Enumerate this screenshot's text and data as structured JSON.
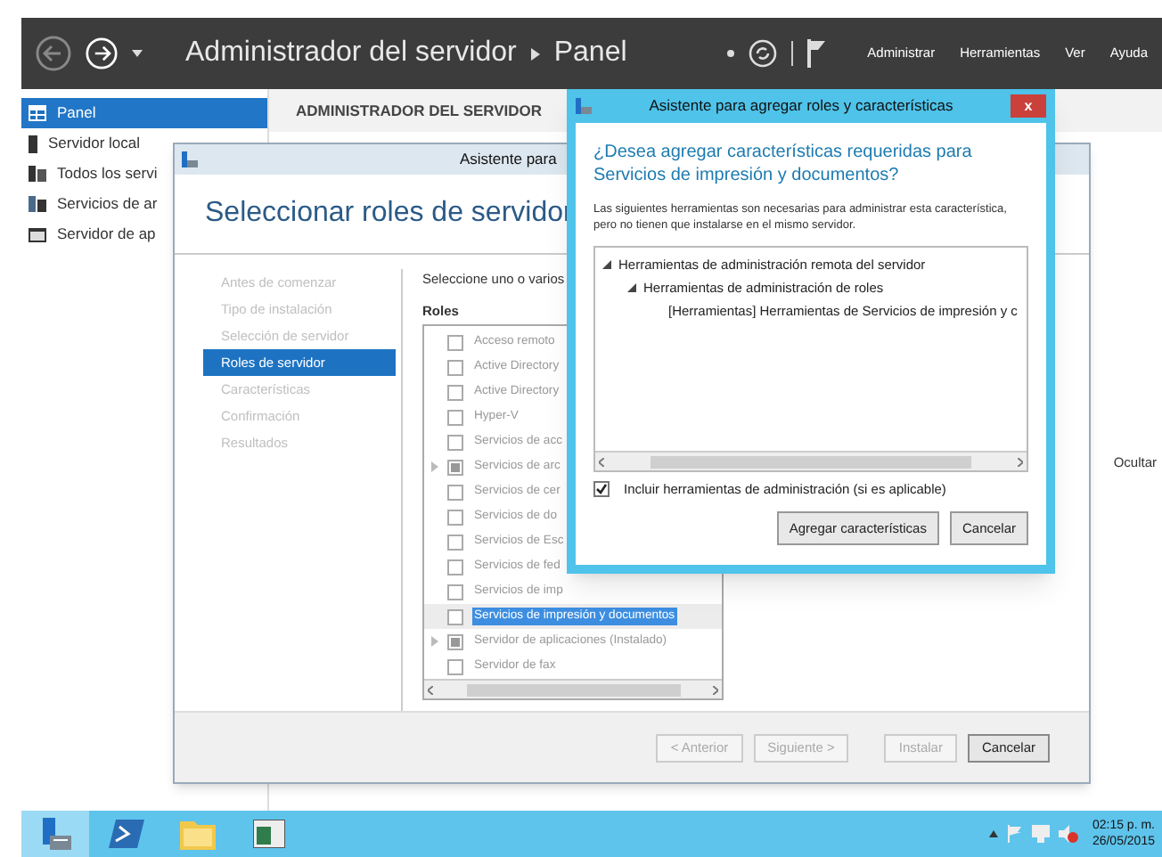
{
  "server_manager": {
    "breadcrumb": [
      "Administrador del servidor",
      "Panel"
    ],
    "menus": [
      "Administrar",
      "Herramientas",
      "Ver",
      "Ayuda"
    ],
    "sidebar": [
      {
        "label": "Panel",
        "selected": true,
        "kind": "dashboard"
      },
      {
        "label": "Servidor local",
        "selected": false,
        "kind": "server"
      },
      {
        "label": "Todos los servi",
        "selected": false,
        "kind": "servers"
      },
      {
        "label": "Servicios de ar",
        "selected": false,
        "kind": "files"
      },
      {
        "label": "Servidor de ap",
        "selected": false,
        "kind": "app"
      }
    ],
    "header": "ADMINISTRADOR DEL SERVIDOR",
    "hide_link": "Ocultar"
  },
  "wizard": {
    "title": "Asistente para",
    "heading": "Seleccionar roles de servidor",
    "steps": [
      {
        "label": "Antes de comenzar",
        "selected": false
      },
      {
        "label": "Tipo de instalación",
        "selected": false
      },
      {
        "label": "Selección de servidor",
        "selected": false
      },
      {
        "label": "Roles de servidor",
        "selected": true
      },
      {
        "label": "Características",
        "selected": false
      },
      {
        "label": "Confirmación",
        "selected": false
      },
      {
        "label": "Resultados",
        "selected": false
      }
    ],
    "instruction": "Seleccione uno o varios",
    "roles_label": "Roles",
    "roles": [
      {
        "label": "Acceso remoto",
        "indeterminate": false,
        "expandable": false,
        "selected": false
      },
      {
        "label": "Active Directory",
        "indeterminate": false,
        "expandable": false,
        "selected": false
      },
      {
        "label": "Active Directory",
        "indeterminate": false,
        "expandable": false,
        "selected": false
      },
      {
        "label": "Hyper-V",
        "indeterminate": false,
        "expandable": false,
        "selected": false
      },
      {
        "label": "Servicios de acc",
        "indeterminate": false,
        "expandable": false,
        "selected": false
      },
      {
        "label": "Servicios de arc",
        "indeterminate": true,
        "expandable": true,
        "selected": false
      },
      {
        "label": "Servicios de cer",
        "indeterminate": false,
        "expandable": false,
        "selected": false
      },
      {
        "label": "Servicios de do",
        "indeterminate": false,
        "expandable": false,
        "selected": false
      },
      {
        "label": "Servicios de Esc",
        "indeterminate": false,
        "expandable": false,
        "selected": false
      },
      {
        "label": "Servicios de fed",
        "indeterminate": false,
        "expandable": false,
        "selected": false
      },
      {
        "label": "Servicios de imp",
        "indeterminate": false,
        "expandable": false,
        "selected": false
      },
      {
        "label": "Servicios de impresión y documentos",
        "indeterminate": false,
        "expandable": false,
        "selected": true
      },
      {
        "label": "Servidor de aplicaciones (Instalado)",
        "indeterminate": true,
        "expandable": true,
        "selected": false
      },
      {
        "label": "Servidor de fax",
        "indeterminate": false,
        "expandable": false,
        "selected": false
      }
    ],
    "buttons": [
      {
        "label": "< Anterior",
        "disabled": true
      },
      {
        "label": "Siguiente >",
        "disabled": true
      },
      {
        "label": "Instalar",
        "disabled": true
      },
      {
        "label": "Cancelar",
        "disabled": false
      }
    ]
  },
  "dialog": {
    "title": "Asistente para agregar roles y características",
    "close": "x",
    "question": "¿Desea agregar características requeridas para Servicios de impresión y documentos?",
    "description": "Las siguientes herramientas son necesarias para administrar esta característica, pero no tienen que instalarse en el mismo servidor.",
    "tree": [
      {
        "label": "Herramientas de administración remota del servidor",
        "expanded": true,
        "children": [
          {
            "label": "Herramientas de administración de roles",
            "expanded": true,
            "children": [
              {
                "label": "[Herramientas] Herramientas de Servicios de impresión y c"
              }
            ]
          }
        ]
      }
    ],
    "include_tools": {
      "label": "Incluir herramientas de administración (si es aplicable)",
      "checked": true
    },
    "buttons": [
      "Agregar características",
      "Cancelar"
    ]
  },
  "taskbar": {
    "apps": [
      {
        "kind": "server",
        "selected": true
      },
      {
        "kind": "powershell",
        "selected": false
      },
      {
        "kind": "folder",
        "selected": false
      },
      {
        "kind": "window",
        "selected": false
      }
    ],
    "time": "02:15 p. m.",
    "date": "26/05/2015"
  }
}
